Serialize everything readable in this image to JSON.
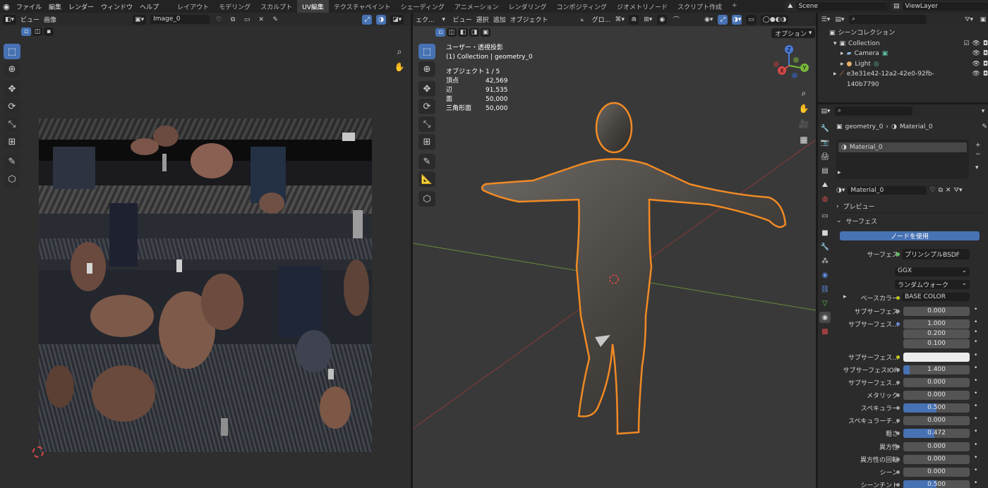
{
  "topbar": {
    "menus": [
      "ファイル",
      "編集",
      "レンダー",
      "ウィンドウ",
      "ヘルプ"
    ],
    "workspaces": [
      "レイアウト",
      "モデリング",
      "スカルプト",
      "UV編集",
      "テクスチャペイント",
      "シェーディング",
      "アニメーション",
      "レンダリング",
      "コンポジティング",
      "ジオメトリノード",
      "スクリプト作成"
    ],
    "active_workspace": "UV編集",
    "scene": "Scene",
    "view_layer": "ViewLayer"
  },
  "uv_editor": {
    "menu_view": "ビュー",
    "menu_image": "画像",
    "image_name": "Image_0"
  },
  "viewport": {
    "menu_truncated": "ェク...",
    "menus": [
      "ビュー",
      "選択",
      "追加",
      "オブジェクト"
    ],
    "orientation": "グロ...",
    "options_label": "オプション",
    "view_name": "ユーザー・透視投影",
    "collection_line": "(1) Collection | geometry_0",
    "stats": [
      {
        "label": "オブジェクト",
        "value": "1 / 5"
      },
      {
        "label": "頂点",
        "value": "42,569"
      },
      {
        "label": "辺",
        "value": "91,535"
      },
      {
        "label": "面",
        "value": "50,000"
      },
      {
        "label": "三角形面",
        "value": "50,000"
      }
    ],
    "gizmo": {
      "x": "X",
      "y": "Y",
      "z": "Z"
    }
  },
  "outliner": {
    "scene_collection": "シーンコレクション",
    "items": [
      "Collection",
      "Camera",
      "Light",
      "e3e31e42-12a2-42e0-92fb-140b7790"
    ]
  },
  "properties": {
    "breadcrumb_object": "geometry_0",
    "breadcrumb_material": "Material_0",
    "slot_name": "Material_0",
    "material_name": "Material_0",
    "preview_label": "プレビュー",
    "surface_label": "サーフェス",
    "use_nodes_label": "ノードを使用",
    "surface_field_label": "サーフェス",
    "surface_shader": "プリンシプルBSDF",
    "distribution": "GGX",
    "subsurface_method": "ランダムウォーク",
    "base_color_label": "ベースカラー",
    "base_color_value": "BASE COLOR",
    "rows": [
      {
        "label": "サブサーフェス",
        "value": "0.000",
        "fill": 0
      },
      {
        "label": "サブサーフェス...",
        "value": "1.000",
        "fill": 0
      },
      {
        "label": "",
        "value": "0.200",
        "fill": 0
      },
      {
        "label": "",
        "value": "0.100",
        "fill": 0
      },
      {
        "label": "サブサーフェス...",
        "value": "",
        "fill": 0
      },
      {
        "label": "サブサーフェスIOR",
        "value": "1.400",
        "fill": 0.1
      },
      {
        "label": "サブサーフェス...",
        "value": "0.000",
        "fill": 0
      },
      {
        "label": "メタリック",
        "value": "0.000",
        "fill": 0
      },
      {
        "label": "スペキュラー",
        "value": "0.500",
        "fill": 0.5
      },
      {
        "label": "スペキュラーチ...",
        "value": "0.000",
        "fill": 0
      },
      {
        "label": "粗さ",
        "value": "0.472",
        "fill": 0.472
      },
      {
        "label": "異方性",
        "value": "0.000",
        "fill": 0
      },
      {
        "label": "異方性の回転",
        "value": "0.000",
        "fill": 0
      },
      {
        "label": "シーン",
        "value": "0.000",
        "fill": 0
      },
      {
        "label": "シーンチント",
        "value": "0.500",
        "fill": 0.5
      }
    ]
  },
  "colors": {
    "accent": "#4772b3",
    "selection_outline": "#f08a24",
    "panel_bg": "#303030",
    "viewport_bg": "#393939"
  }
}
